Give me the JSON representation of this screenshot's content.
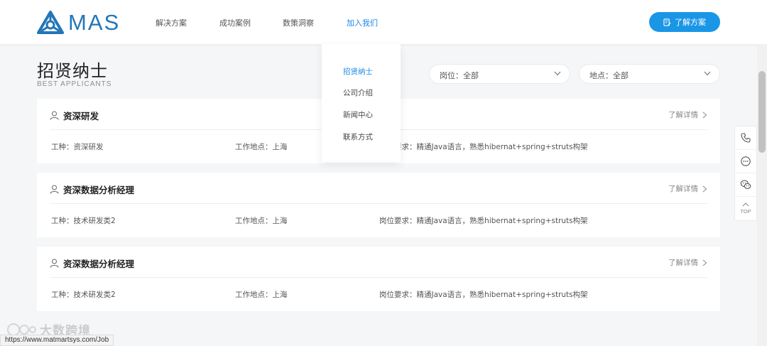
{
  "header": {
    "logo_text": "MAS",
    "nav": [
      {
        "label": "解决方案"
      },
      {
        "label": "成功案例"
      },
      {
        "label": "数策洞察"
      },
      {
        "label": "加入我们"
      }
    ],
    "cta_label": "了解方案",
    "accent_color": "#1a96e6"
  },
  "dropdown": {
    "items": [
      {
        "label": "招贤纳士"
      },
      {
        "label": "公司介绍"
      },
      {
        "label": "新闻中心"
      },
      {
        "label": "联系方式"
      }
    ]
  },
  "page": {
    "title": "招贤纳士",
    "subtitle": "BEST APPLICANTS"
  },
  "filters": {
    "position": "岗位：全部",
    "location": "地点：全部"
  },
  "jobs": [
    {
      "title": "资深研发",
      "more": "了解详情",
      "type": "工种：资深研发",
      "location": "工作地点：上海",
      "requirement": "岗位要求：精通Java语言，熟悉hibernat+spring+struts构架"
    },
    {
      "title": "资深数据分析经理",
      "more": "了解详情",
      "type": "工种：技术研发类2",
      "location": "工作地点：上海",
      "requirement": "岗位要求：精通Java语言，熟悉hibernat+spring+struts构架"
    },
    {
      "title": "资深数据分析经理",
      "more": "了解详情",
      "type": "工种：技术研发类2",
      "location": "工作地点：上海",
      "requirement": "岗位要求：精通Java语言，熟悉hibernat+spring+struts构架"
    }
  ],
  "float_bar": {
    "items": [
      "phone-icon",
      "chat-icon",
      "wechat-icon",
      "top-icon"
    ],
    "top_label": "TOP"
  },
  "status_url": "https://www.matmartsys.com/Job",
  "watermark_text": "大数跨境"
}
